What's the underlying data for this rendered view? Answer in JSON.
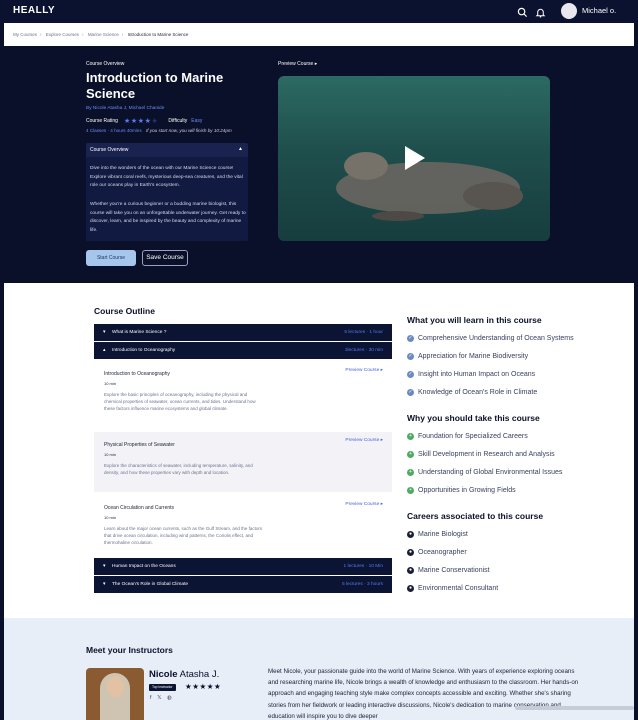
{
  "header": {
    "logo": "HEALLY",
    "user_name": "Michael o.",
    "icons": [
      "search-icon",
      "bell-icon"
    ]
  },
  "breadcrumb": [
    "My Courses",
    "Explore Courses",
    "Marine Science",
    "Introduction to Marine Science"
  ],
  "course": {
    "kicker": "Course Overview",
    "title": "Introduction to Marine Science",
    "authors": "By Nicole Atasha J, Michael Chanide",
    "rating_label": "Course Rating",
    "rating": 4,
    "rating_max": 5,
    "difficulty_label": "Difficulty",
    "difficulty": "Easy",
    "meta": "4 Classes · 4 hours 40mins",
    "finish_note": "If you start now, you will finish by 10:24pm",
    "overview_title": "Course Overview",
    "overview_p1": "Dive into the wonders of the ocean with our Marine Science course! Explore vibrant coral reefs, mysterious deep-sea creatures, and the vital role our oceans play in Earth's ecosystem.",
    "overview_p2": "Whether you're a curious beginner or a budding marine biologist, this course will take you on an unforgettable underwater journey. Get ready to discover, learn, and be inspired by the beauty and complexity of marine life.",
    "start_label": "Start Course",
    "save_label": "Save Course",
    "preview_label": "Preview Course"
  },
  "outline": {
    "title": "Course Outline",
    "sections": [
      {
        "title": "What is Marine Science ?",
        "meta": "5 lectures · 1 hour",
        "open": false
      },
      {
        "title": "Introduction to Oceanography",
        "meta": "3lectures · 30 min",
        "open": true
      },
      {
        "title": "Human Impact on the Oceans",
        "meta": "1 lectures · 10 Min",
        "open": false
      },
      {
        "title": "The Ocean's Role in Global Climate",
        "meta": "5 lectures · 3 hours",
        "open": false
      }
    ],
    "lessons": [
      {
        "title": "Introduction to Oceanography",
        "duration": "10 min",
        "preview": "Preview Course",
        "desc": "Explore the basic principles of oceanography, including the physical and chemical properties of seawater, ocean currents, and tides. Understand how these factors influence marine ecosystems and global climate."
      },
      {
        "title": "Physical Properties of Seawater",
        "duration": "10 min",
        "preview": "Preview Course",
        "desc": "Explore the characteristics of seawater, including temperature, salinity, and density, and how these properties vary with depth and location."
      },
      {
        "title": "Ocean Circulation and Currents",
        "duration": "10 min",
        "preview": "Preview Course",
        "desc": "Learn about the major ocean currents, such as the Gulf Stream, and the factors that drive ocean circulation, including wind patterns, the Coriolis effect, and thermohaline circulation."
      }
    ]
  },
  "learn": {
    "title": "What you will learn in  this course",
    "items": [
      "Comprehensive Understanding of Ocean Systems",
      "Appreciation for Marine Biodiversity",
      "Insight into Human Impact on Oceans",
      "Knowledge of Ocean's Role in Climate"
    ]
  },
  "why": {
    "title": "Why you should take this course",
    "items": [
      "Foundation for Specialized Careers",
      "Skill Development in Research and Analysis",
      "Understanding of Global Environmental Issues",
      "Opportunities in Growing Fields"
    ]
  },
  "careers": {
    "title": "Careers associated to this course",
    "items": [
      "Marine Biologist",
      "Oceanographer",
      "Marine Conservationist",
      "Environmental Consultant"
    ]
  },
  "instructors": {
    "title": "Meet your Instructors",
    "first_name": "Nicole",
    "last_name": "Atasha J.",
    "badge": "Top Instructor",
    "rating": 5,
    "social": [
      "facebook-icon",
      "x-icon",
      "globe-icon"
    ],
    "bio": "Meet Nicole, your passionate guide into the world of Marine Science. With years of experience exploring oceans and researching marine life, Nicole brings a wealth of knowledge and enthusiasm to the classroom. Her hands-on approach and engaging teaching style make complex concepts accessible and exciting. Whether she's sharing stories from her fieldwork or leading interactive discussions, Nicole's dedication to marine conservation and education will inspire you to dive deeper"
  },
  "colors": {
    "navy": "#0a1029",
    "accent_blue": "#5a78f0",
    "green_check": "#4faa63",
    "start_button": "#a6c6ec"
  }
}
